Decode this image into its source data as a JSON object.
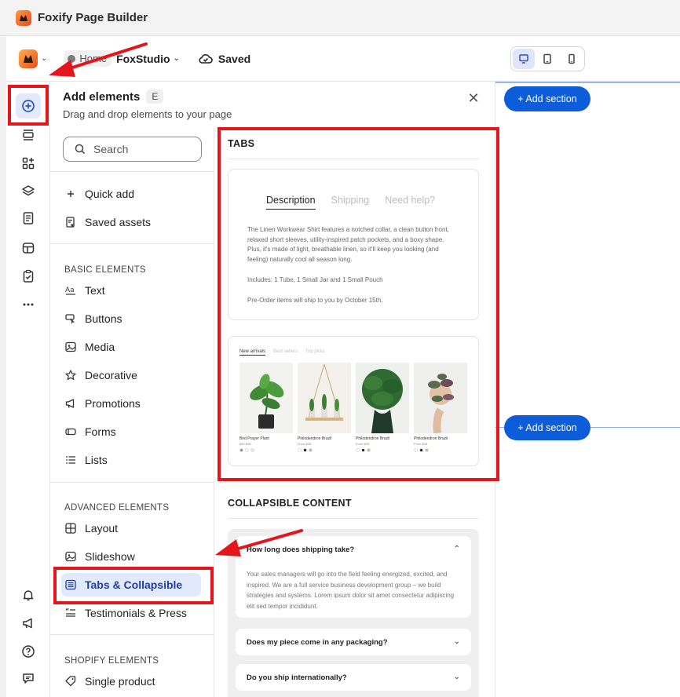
{
  "window": {
    "title": "Foxify Page Builder"
  },
  "header": {
    "breadcrumb_home": "Home",
    "store_name": "FoxStudio",
    "saved_label": "Saved",
    "devices": [
      "desktop-icon",
      "tablet-icon",
      "mobile-icon"
    ]
  },
  "rail": {
    "items": [
      "add-elements-icon",
      "sections-icon",
      "apps-icon",
      "layers-icon",
      "pages-icon",
      "theme-icon",
      "checklist-icon",
      "more-icon"
    ],
    "bottom_items": [
      "bell-icon",
      "megaphone-icon",
      "help-icon",
      "chat-icon"
    ]
  },
  "panel": {
    "title": "Add elements",
    "shortcut": "E",
    "subtitle": "Drag and drop elements to your page",
    "search_placeholder": "Search",
    "top_items": [
      "Quick add",
      "Saved assets"
    ],
    "basic_label": "BASIC ELEMENTS",
    "basic_items": [
      "Text",
      "Buttons",
      "Media",
      "Decorative",
      "Promotions",
      "Forms",
      "Lists"
    ],
    "advanced_label": "ADVANCED ELEMENTS",
    "advanced_items": [
      "Layout",
      "Slideshow",
      "Tabs & Collapsible",
      "Testimonials & Press"
    ],
    "shopify_label": "SHOPIFY ELEMENTS",
    "shopify_items": [
      "Single product"
    ]
  },
  "tabs_section": {
    "title": "TABS",
    "tab_labels": [
      "Description",
      "Shipping",
      "Need help?"
    ],
    "paragraphs": [
      "The Linen Workwear Shirt features a notched collar, a clean button front, relaxed short sleeves, utility-inspired patch pockets, and a boxy shape. Plus, it's made of light, breathable linen, so it'll keep you looking (and feeling) naturally cool all season long.",
      "Includes: 1 Tube, 1 Small Jar and 1 Small Pouch",
      "Pre-Order items will ship to you by October 15th."
    ],
    "product_tabs": [
      "New arrivals",
      "Best sellers",
      "Top picks"
    ],
    "products": [
      {
        "name": "Bird Prayer Plant",
        "price": "$30 $38"
      },
      {
        "name": "Philodendron Brazil",
        "price": "From $28"
      },
      {
        "name": "Philodendron Brazil",
        "price": "From $28"
      },
      {
        "name": "Philodendron Brazil",
        "price": "From $28"
      }
    ]
  },
  "collapsible_section": {
    "title": "COLLAPSIBLE CONTENT",
    "items": [
      {
        "question": "How long does shipping take?",
        "answer": "Your sales managers will go into the field feeling energized, excited, and inspired. We are a full service business development group – we build strategies and systems. Lorem ipsum dolor sit amet consectetur adipiscing elit sed tempor incididunt."
      },
      {
        "question": "Does my piece come in any packaging?"
      },
      {
        "question": "Do you ship internationally?"
      }
    ]
  },
  "canvas": {
    "add_section_label": "+ Add section"
  },
  "colors": {
    "accent": "#0d5ddb",
    "annotation": "#e5151c",
    "active_bg": "#e2e9fc"
  }
}
